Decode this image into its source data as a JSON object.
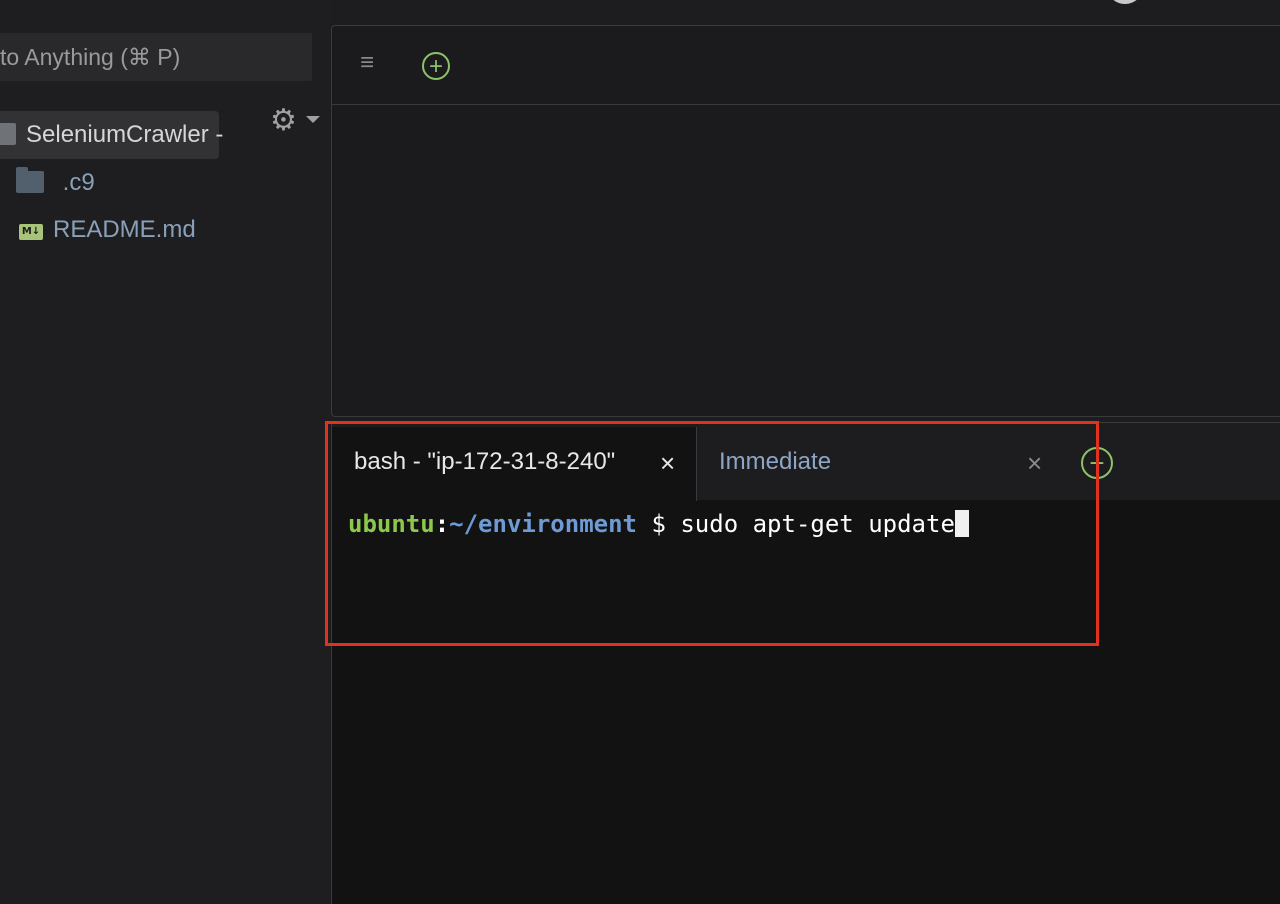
{
  "sidebar": {
    "goto_text": "to Anything (⌘ P)",
    "tree": {
      "root_label": "SeleniumCrawler -",
      "items": [
        {
          "label": ".c9",
          "icon": "folder-icon"
        },
        {
          "label": "README.md",
          "icon": "markdown-file-icon",
          "badge": "M↓"
        }
      ]
    }
  },
  "editor": {
    "menu_icon": "≡",
    "add_icon": "+"
  },
  "terminal": {
    "tabs": [
      {
        "label": "bash - \"ip-172-31-8-240\"",
        "close": "×",
        "active": true
      },
      {
        "label": "Immediate",
        "close": "×",
        "active": false
      }
    ],
    "add_icon": "+",
    "prompt_user": "ubuntu",
    "prompt_colon": ":",
    "prompt_path": "~/environment",
    "prompt_symbol": " $ ",
    "command": "sudo apt-get update"
  },
  "colors": {
    "highlight": "#e0321e",
    "prompt_user": "#8cc84b",
    "prompt_path": "#6e9bd6",
    "accent_add": "#8cc36a"
  }
}
